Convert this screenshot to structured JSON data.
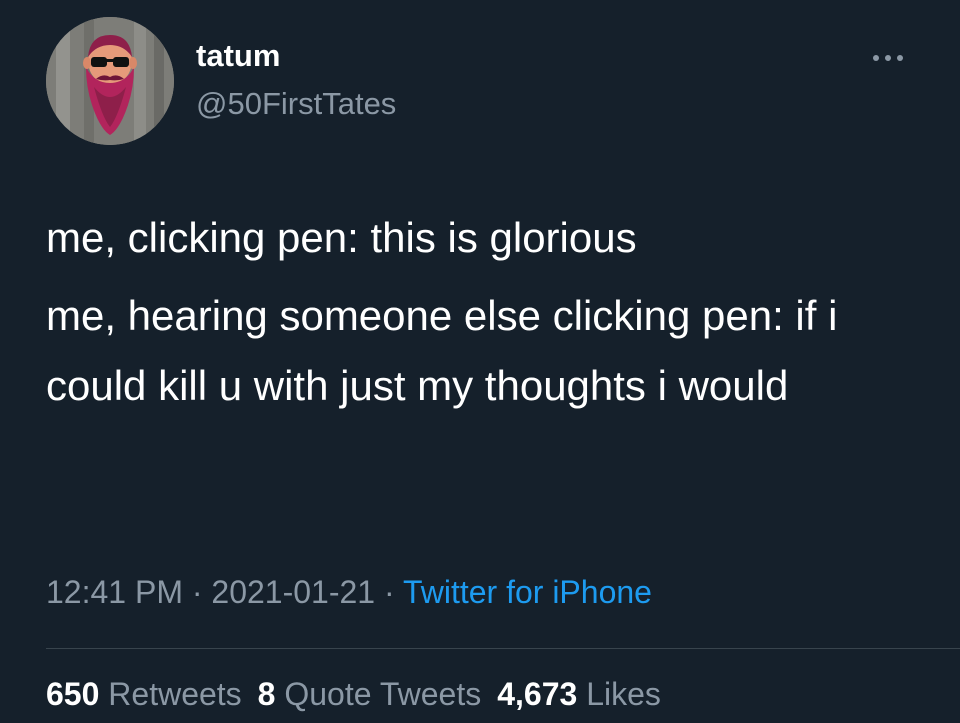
{
  "user": {
    "display_name": "tatum",
    "handle": "@50FirstTates",
    "avatar_icon": "bearded-man-sunglasses-avatar"
  },
  "tweet": {
    "paragraphs": [
      "me, clicking pen: this is glorious",
      "me, hearing someone else clicking pen: if i could kill u with just my thoughts i would"
    ],
    "time": "12:41 PM",
    "separator": " · ",
    "date": "2021-01-21",
    "source": "Twitter for iPhone"
  },
  "stats": {
    "retweets_count": "650",
    "retweets_label": "Retweets",
    "quotes_count": "8",
    "quotes_label": "Quote Tweets",
    "likes_count": "4,673",
    "likes_label": "Likes"
  },
  "colors": {
    "background": "#15202b",
    "primary_text": "#ffffff",
    "secondary_text": "#8b98a5",
    "link": "#1d9bf0",
    "divider": "#38444d"
  },
  "icons": {
    "more": "more-horizontal-icon"
  }
}
